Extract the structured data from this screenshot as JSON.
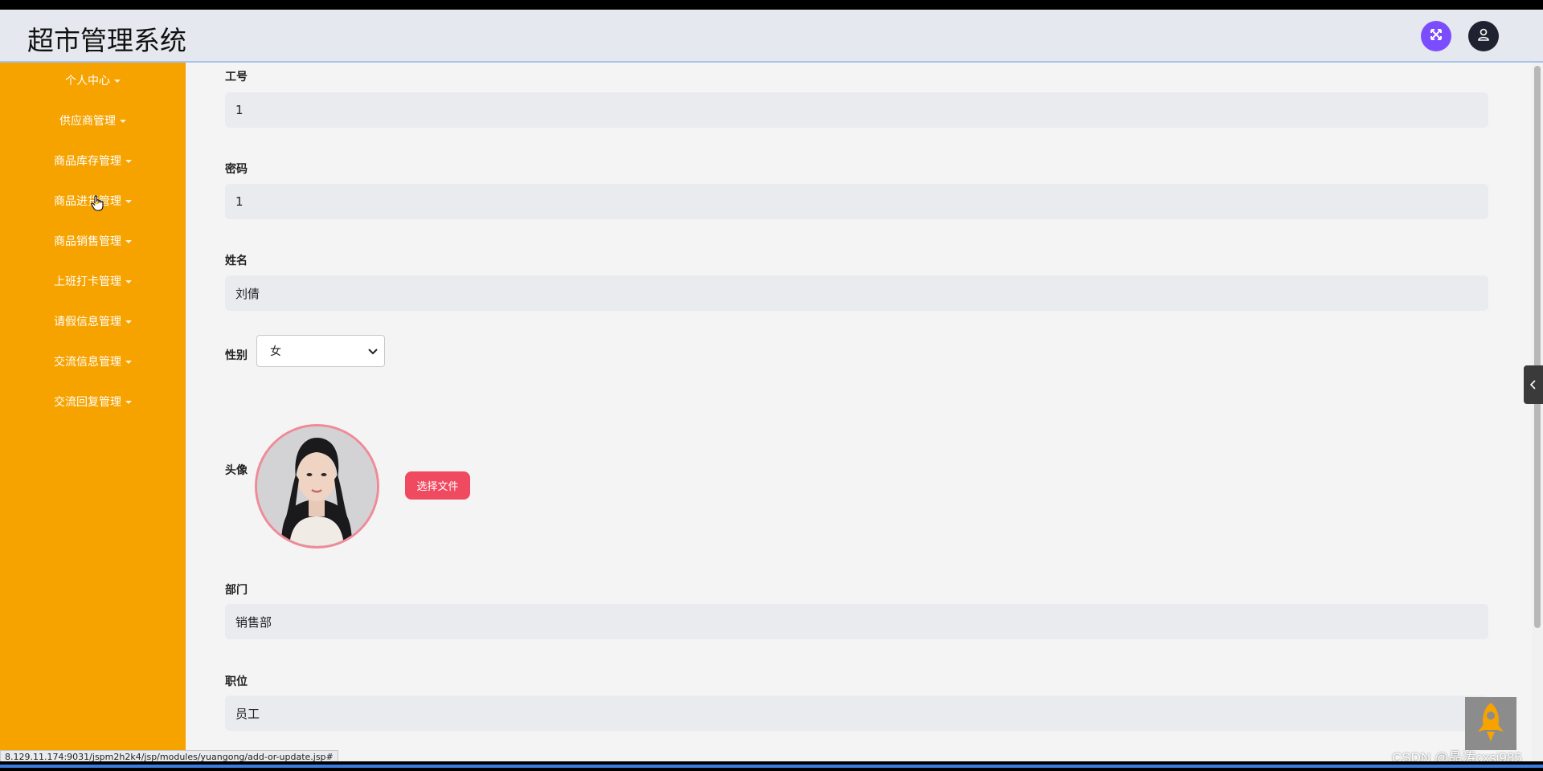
{
  "app": {
    "title": "超市管理系统"
  },
  "header": {
    "expand_icon": "expand-arrows-icon",
    "user_icon": "user-icon"
  },
  "sidebar": {
    "items": [
      {
        "label": "个人中心"
      },
      {
        "label": "供应商管理"
      },
      {
        "label": "商品库存管理"
      },
      {
        "label": "商品进货管理"
      },
      {
        "label": "商品销售管理"
      },
      {
        "label": "上班打卡管理"
      },
      {
        "label": "请假信息管理"
      },
      {
        "label": "交流信息管理"
      },
      {
        "label": "交流回复管理"
      }
    ]
  },
  "form": {
    "employee_no": {
      "label": "工号",
      "value": "1"
    },
    "password": {
      "label": "密码",
      "value": "1"
    },
    "name": {
      "label": "姓名",
      "value": "刘倩"
    },
    "gender": {
      "label": "性别",
      "value": "女"
    },
    "avatar": {
      "label": "头像",
      "button": "选择文件"
    },
    "department": {
      "label": "部门",
      "value": "销售部"
    },
    "position": {
      "label": "职位",
      "value": "员工"
    }
  },
  "status": {
    "url": "8.129.11.174:9031/jspm2h2k4/jsp/modules/yuangong/add-or-update.jsp#"
  },
  "watermark": "CSDN @晶涛cxsj985",
  "colors": {
    "sidebar": "#f6a300",
    "primary_button": "#ef4a60",
    "expand_button": "#7c4dff"
  }
}
